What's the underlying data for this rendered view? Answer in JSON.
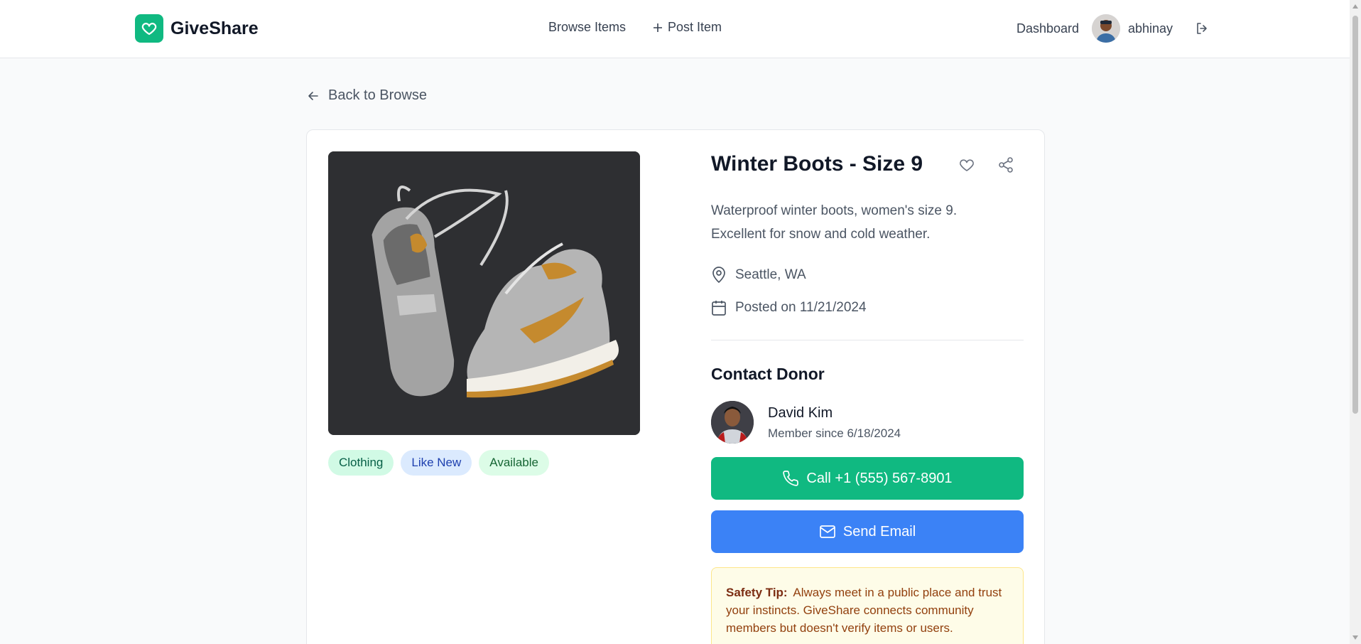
{
  "header": {
    "brand": "GiveShare",
    "nav": {
      "browse": "Browse Items",
      "post": "Post Item"
    },
    "dashboard": "Dashboard",
    "username": "abhinay"
  },
  "back_link": "Back to Browse",
  "item": {
    "image_alt": "Pair of grey and tan high-top sneakers",
    "tags": {
      "category": "Clothing",
      "condition": "Like New",
      "status": "Available"
    },
    "title": "Winter Boots - Size 9",
    "description": "Waterproof winter boots, women's size 9. Excellent for snow and cold weather.",
    "location": "Seattle, WA",
    "posted": "Posted on 11/21/2024"
  },
  "contact": {
    "heading": "Contact Donor",
    "donor_name": "David Kim",
    "member_since": "Member since 6/18/2024",
    "call_label": "Call +1 (555) 567-8901",
    "email_label": "Send Email"
  },
  "safety": {
    "label": "Safety Tip:",
    "text": "Always meet in a public place and trust your instincts. GiveShare connects community members but doesn't verify items or users."
  },
  "colors": {
    "brand": "#10b981",
    "email_button": "#3b82f6"
  }
}
